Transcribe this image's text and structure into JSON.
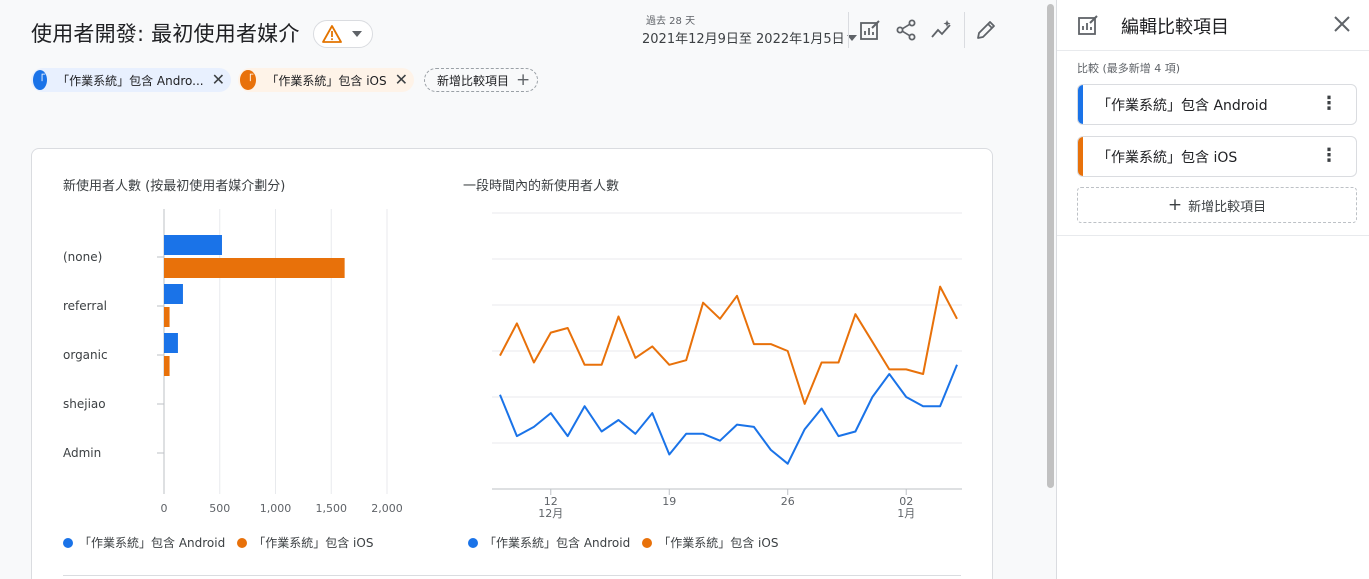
{
  "header": {
    "title": "使用者開發: 最初使用者媒介",
    "date_preset": "過去 28 天",
    "date_range": "2021年12月9日至 2022年1月5日",
    "icons": [
      "customize-report-icon",
      "share-icon",
      "insights-icon",
      "edit-icon"
    ]
  },
  "chips": [
    {
      "label": "「作業系統」包含 Andro...",
      "color": "#1a73e8",
      "dot": "「"
    },
    {
      "label": "「作業系統」包含 iOS",
      "color": "#e8710a",
      "dot": "「"
    }
  ],
  "add_comparison_label": "新增比較項目",
  "bar_chart": {
    "title": "新使用者人數 (按最初使用者媒介劃分)",
    "chart_data": {
      "type": "bar",
      "orientation": "horizontal",
      "categories": [
        "(none)",
        "referral",
        "organic",
        "shejiao",
        "Admin"
      ],
      "series": [
        {
          "name": "「作業系統」包含 Android",
          "color": "#1a73e8",
          "values": [
            520,
            170,
            125,
            0,
            0
          ]
        },
        {
          "name": "「作業系統」包含 iOS",
          "color": "#e8710a",
          "values": [
            1620,
            50,
            50,
            0,
            0
          ]
        }
      ],
      "xlim": [
        0,
        2000
      ],
      "xticks": [
        "0",
        "500",
        "1,000",
        "1,500",
        "2,000"
      ],
      "grid": true,
      "legend": "bottom"
    }
  },
  "line_chart": {
    "title": "一段時間內的新使用者人數",
    "chart_data": {
      "type": "line",
      "x": [
        "2021-12-09",
        "2021-12-10",
        "2021-12-11",
        "2021-12-12",
        "2021-12-13",
        "2021-12-14",
        "2021-12-15",
        "2021-12-16",
        "2021-12-17",
        "2021-12-18",
        "2021-12-19",
        "2021-12-20",
        "2021-12-21",
        "2021-12-22",
        "2021-12-23",
        "2021-12-24",
        "2021-12-25",
        "2021-12-26",
        "2021-12-27",
        "2021-12-28",
        "2021-12-29",
        "2021-12-30",
        "2021-12-31",
        "2022-01-01",
        "2022-01-02",
        "2022-01-03",
        "2022-01-04",
        "2022-01-05"
      ],
      "series": [
        {
          "name": "「作業系統」包含 Android",
          "color": "#1a73e8",
          "values": [
            41,
            23,
            27,
            33,
            23,
            36,
            25,
            30,
            24,
            33,
            15,
            24,
            24,
            21,
            28,
            27,
            17,
            11,
            26,
            35,
            23,
            25,
            40,
            50,
            40,
            36,
            36,
            54
          ]
        },
        {
          "name": "「作業系統」包含 iOS",
          "color": "#e8710a",
          "values": [
            58,
            72,
            55,
            68,
            70,
            54,
            54,
            75,
            57,
            62,
            54,
            56,
            81,
            74,
            84,
            63,
            63,
            60,
            37,
            55,
            55,
            76,
            64,
            52,
            52,
            50,
            88,
            74
          ]
        }
      ],
      "ylim": [
        0,
        120
      ],
      "yticks": [
        "0",
        "20",
        "40",
        "60",
        "80",
        "100",
        "120"
      ],
      "xticks": [
        {
          "day": "12",
          "month": "12月",
          "date": "2021-12-12"
        },
        {
          "day": "19",
          "month": "",
          "date": "2021-12-19"
        },
        {
          "day": "26",
          "month": "",
          "date": "2021-12-26"
        },
        {
          "day": "02",
          "month": "1月",
          "date": "2022-01-02"
        }
      ],
      "grid": true,
      "legend": "bottom"
    }
  },
  "side_panel": {
    "title": "編輯比較項目",
    "subtitle": "比較 (最多新增 4 項)",
    "comparisons": [
      {
        "label": "「作業系統」包含 Android",
        "color": "#1a73e8"
      },
      {
        "label": "「作業系統」包含 iOS",
        "color": "#e8710a"
      }
    ],
    "add_label": "新增比較項目"
  },
  "colors": {
    "android": "#1a73e8",
    "ios": "#e8710a",
    "warning": "#e37400"
  }
}
